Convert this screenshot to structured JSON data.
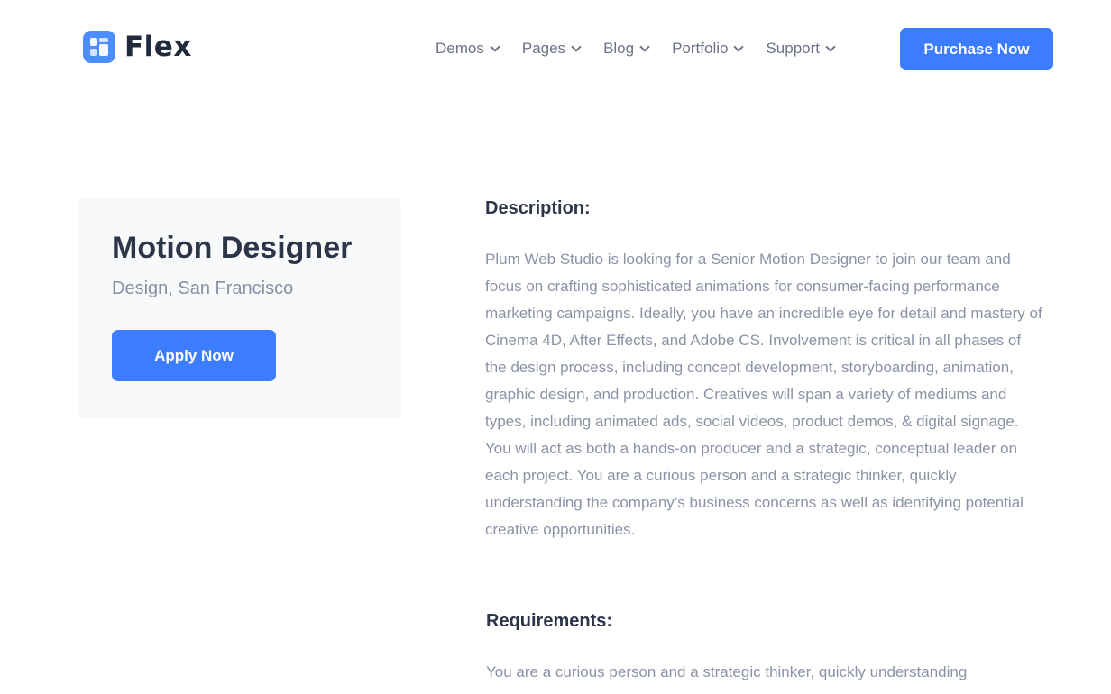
{
  "header": {
    "logo_text": "Flex",
    "nav": [
      {
        "label": "Demos"
      },
      {
        "label": "Pages"
      },
      {
        "label": "Blog"
      },
      {
        "label": "Portfolio"
      },
      {
        "label": "Support"
      }
    ],
    "purchase_label": "Purchase Now"
  },
  "job": {
    "title": "Motion Designer",
    "meta": "Design, San Francisco",
    "apply_label": "Apply Now"
  },
  "description": {
    "heading": "Description:",
    "text": "Plum Web Studio is looking for a Senior Motion Designer to join our team and focus on crafting sophisticated animations for consumer-facing performance marketing campaigns. Ideally, you have an incredible eye for detail and mastery of Cinema 4D, After Effects, and Adobe CS. Involvement is critical in all phases of the design process, including concept development, storyboarding, animation, graphic design, and production. Creatives will span a variety of mediums and types, including animated ads, social videos, product demos, & digital signage. You will act as both a hands-on producer and a strategic, conceptual leader on each project. You are a curious person and a strategic thinker, quickly understanding the company’s business concerns as well as identifying potential creative opportunities."
  },
  "requirements": {
    "heading": "Requirements:",
    "text": "You are a curious person and a strategic thinker, quickly understanding"
  },
  "colors": {
    "accent": "#3c7cff",
    "heading": "#2d3648",
    "body": "#8a93a5",
    "card_bg": "#f8f9fb"
  },
  "icons": {
    "logo": "flex-logo-icon",
    "dropdown": "chevron-down-icon"
  }
}
